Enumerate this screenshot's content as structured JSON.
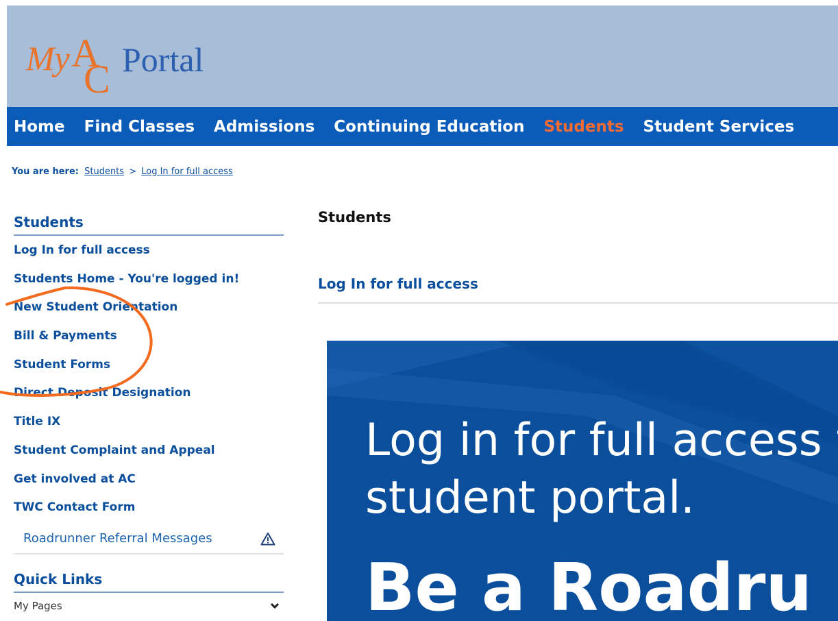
{
  "logo": {
    "my": "My",
    "a": "A",
    "c": "C",
    "portal": "Portal"
  },
  "nav": {
    "items": [
      {
        "label": "Home"
      },
      {
        "label": "Find Classes"
      },
      {
        "label": "Admissions"
      },
      {
        "label": "Continuing Education"
      },
      {
        "label": "Students"
      },
      {
        "label": "Student Services"
      }
    ],
    "active": "Students"
  },
  "breadcrumb": {
    "label": "You are here:",
    "links": [
      "Students",
      "Log In for full access"
    ],
    "separator": ">"
  },
  "sidebar": {
    "title": "Students",
    "items": [
      {
        "label": "Log In for full access"
      },
      {
        "label": "Students Home - You're logged in!"
      },
      {
        "label": "New Student Orientation"
      },
      {
        "label": "Bill & Payments"
      },
      {
        "label": "Student Forms"
      },
      {
        "label": "Direct Deposit Designation"
      },
      {
        "label": "Title IX"
      },
      {
        "label": "Student Complaint and Appeal"
      },
      {
        "label": "Get involved at AC"
      },
      {
        "label": "TWC Contact Form"
      }
    ],
    "sub_item": {
      "label": "Roadrunner Referral Messages",
      "icon": "warning-icon"
    }
  },
  "quick_links": {
    "title": "Quick Links",
    "select_value": "My Pages"
  },
  "main": {
    "title": "Students",
    "link": "Log In for full access"
  },
  "banner": {
    "line1": "Log in for full access t",
    "line2": "student portal.",
    "big": "Be a Roadru"
  },
  "colors": {
    "header_bg": "#a8bdd8",
    "nav_bg": "#0b5cb8",
    "nav_active": "#f26b35",
    "link": "#0b4f9c",
    "banner_bg": "#0b4f9c",
    "annotation": "#f26b1f"
  }
}
